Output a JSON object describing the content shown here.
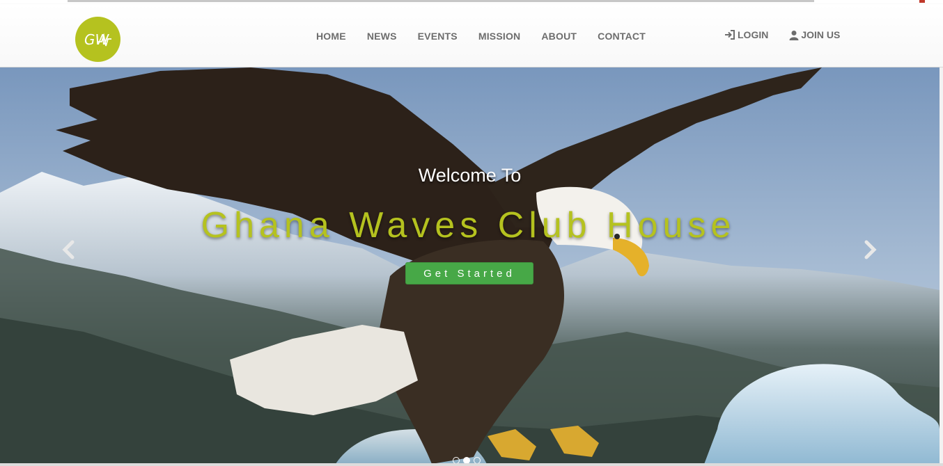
{
  "header": {
    "logo_text": "GW",
    "nav": [
      {
        "label": "HOME"
      },
      {
        "label": "NEWS"
      },
      {
        "label": "EVENTS"
      },
      {
        "label": "MISSION"
      },
      {
        "label": "ABOUT"
      },
      {
        "label": "CONTACT"
      }
    ],
    "login": {
      "label": "LOGIN",
      "icon": "login-icon"
    },
    "join": {
      "label": "JOIN US",
      "icon": "user-icon"
    }
  },
  "hero": {
    "welcome": "Welcome To",
    "title": "Ghana Waves Club House",
    "cta_label": "Get Started",
    "slides_count": 3,
    "active_slide": 2
  },
  "colors": {
    "brand": "#b5c21f",
    "cta": "#47a847",
    "nav_text": "#6d6d6d"
  }
}
